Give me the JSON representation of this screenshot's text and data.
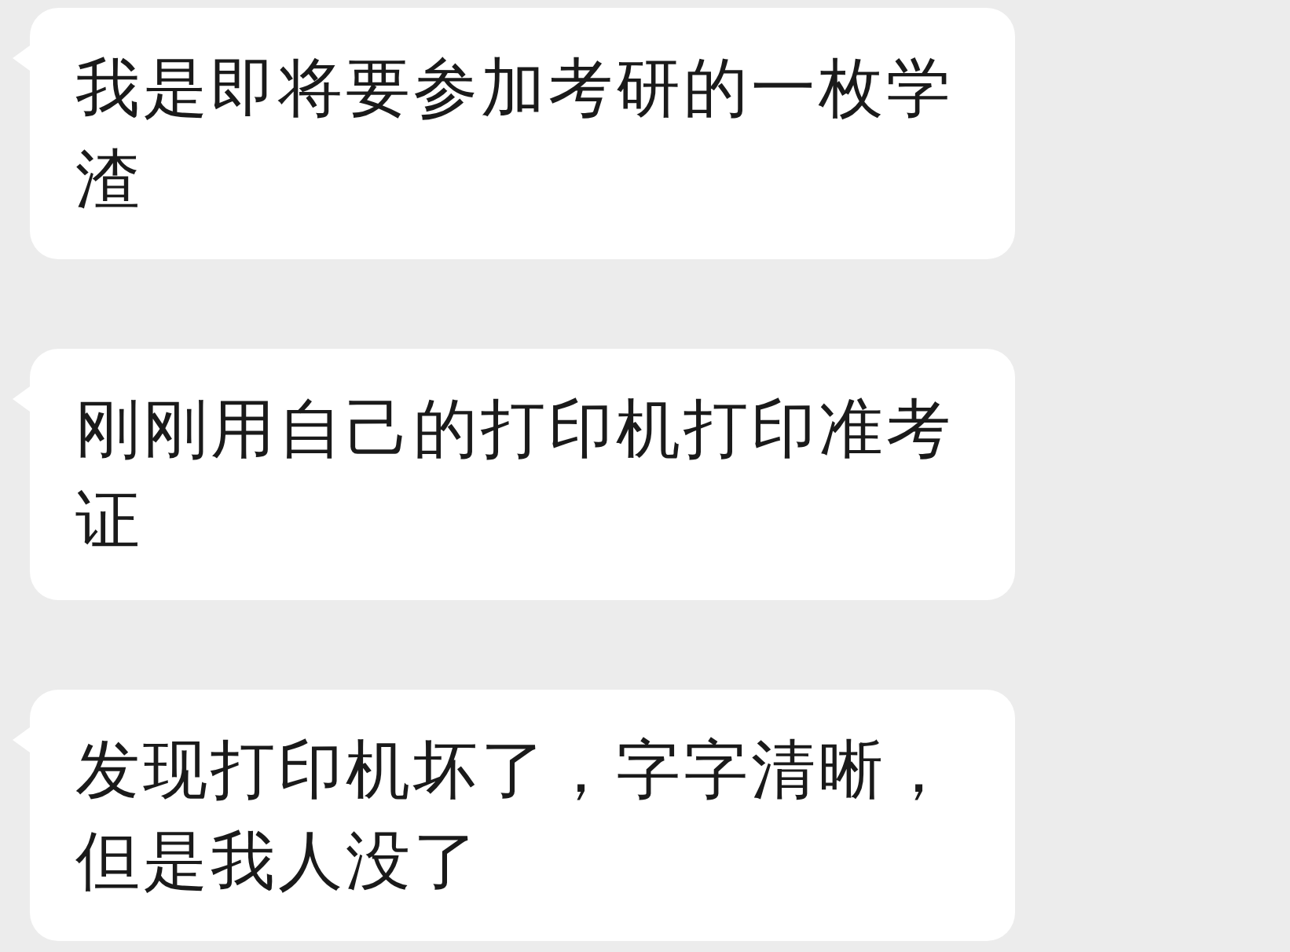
{
  "messages": [
    {
      "text": "我是即将要参加考研的一枚学渣"
    },
    {
      "text": "刚刚用自己的打印机打印准考证"
    },
    {
      "text": "发现打印机坏了，字字清晰，但是我人没了"
    }
  ]
}
